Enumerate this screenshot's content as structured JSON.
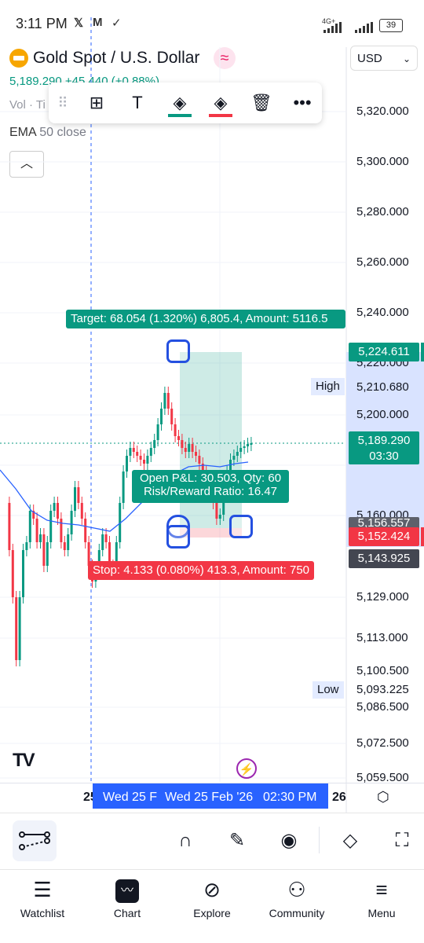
{
  "status": {
    "time": "3:11 PM",
    "icons": [
      "x-icon",
      "gmail-icon",
      "check-circle-icon"
    ],
    "network": "4G+",
    "battery": "39"
  },
  "header": {
    "symbol_title": "Gold Spot / U.S. Dollar",
    "price_line": "5,189.290 +45.440 (+0.88%)",
    "vol_label": "Vol · Ti",
    "ema_name": "EMA",
    "ema_value": "50 close",
    "currency": "USD"
  },
  "toolbar": {
    "items": [
      "drag-handle",
      "add-object",
      "text",
      "fill-green",
      "fill-red",
      "delete",
      "more"
    ]
  },
  "chart": {
    "axis_labels": [
      "5,320.000",
      "5,300.000",
      "5,280.000",
      "5,260.000",
      "5,240.000",
      "5,220.000",
      "5,200.000",
      "5,160.000",
      "5,129.000",
      "5,113.000",
      "5,100.500",
      "5,086.500",
      "5,072.500",
      "5,059.500"
    ],
    "target_price": "5,224.611",
    "high_label": "High",
    "high_price": "5,210.680",
    "current_price": "5,189.290",
    "countdown": "03:30",
    "price_a": "5,156.557",
    "stop_price": "5,152.424",
    "price_b": "5,143.925",
    "low_label": "Low",
    "low_price": "5,093.225",
    "target_text": "Target: 68.054 (1.320%) 6,805.4, Amount: 5116.5",
    "pnl_text": "Open P&L: 30.503, Qty: 60",
    "rr_text": "Risk/Reward Ratio: 16.47",
    "stop_text": "Stop: 4.133 (0.080%) 413.3, Amount: 750",
    "time_left": "25",
    "time_a": "Wed 25 F",
    "time_b": "Wed 25 Feb '26",
    "time_c": "02:30 PM",
    "time_right": "26",
    "colors": {
      "up": "#089981",
      "down": "#f23645",
      "ema": "#2962ff",
      "crosshair": "#2962ff"
    }
  },
  "bottom_tools": [
    "drawing-tools-icon",
    "magnet-icon",
    "lock-drawing-icon",
    "eye-icon",
    "layers-icon",
    "fullscreen-icon"
  ],
  "nav": [
    {
      "label": "Watchlist",
      "icon": "watchlist-icon"
    },
    {
      "label": "Chart",
      "icon": "chart-icon"
    },
    {
      "label": "Explore",
      "icon": "compass-icon"
    },
    {
      "label": "Community",
      "icon": "community-icon"
    },
    {
      "label": "Menu",
      "icon": "menu-icon"
    }
  ]
}
